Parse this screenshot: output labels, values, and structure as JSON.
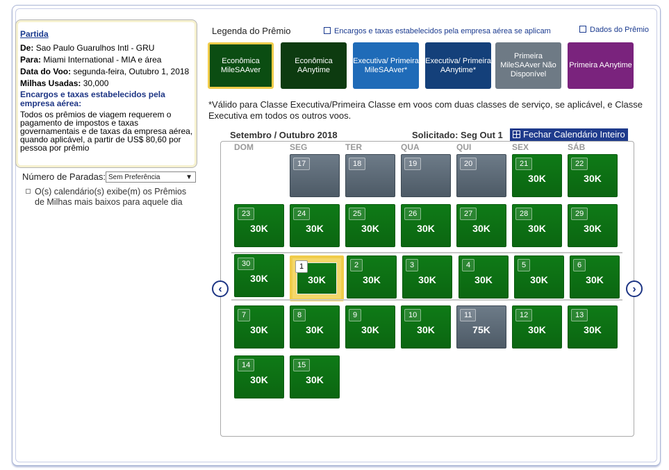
{
  "summary": {
    "departure_label": "Partida",
    "from_label": "De:",
    "from_value": "Sao Paulo Guarulhos Intl - GRU",
    "to_label": "Para:",
    "to_value": "Miami International - MIA e área",
    "date_label": "Data do Voo:",
    "date_value": "segunda-feira, Outubro 1, 2018",
    "miles_label": "Milhas Usadas:",
    "miles_value": "30,000",
    "fees_title": "Encargos e taxas estabelecidos pela empresa aérea:",
    "fees_text": "Todos os prêmios de viagem requerem o pagamento de impostos e taxas governamentais e de taxas da empresa aérea, quando aplicável, a partir de US$ 80,60 por pessoa por prêmio"
  },
  "stops": {
    "label": "Número de Paradas:",
    "selected": "Sem Preferência"
  },
  "calendar_note": "O(s) calendário(s) exibe(m) os Prêmios de Milhas mais baixos para aquele dia",
  "legend": {
    "title": "Legenda do Prêmio",
    "fees_link": "Encargos e taxas estabelecidos pela empresa aérea se aplicam",
    "details_link": "Dados do Prêmio",
    "items": [
      {
        "label": "Econômica MileSAAver",
        "color": "#0b4d12"
      },
      {
        "label": "Econômica AAnytime",
        "color": "#0d3b10"
      },
      {
        "label": "Executiva/ Primeira MileSAAver*",
        "color": "#1f6bb8"
      },
      {
        "label": "Executiva/ Primeira AAnytime*",
        "color": "#14407a"
      },
      {
        "label": "Primeira MileSAAver Não Disponível",
        "color": "#6e7a85"
      },
      {
        "label": "Primeira AAnytime",
        "color": "#7a237d"
      }
    ]
  },
  "note": "*Válido para Classe Executiva/Primeira Classe em voos com duas classes de serviço, se aplicável, e Classe Executiva em todos os outros voos.",
  "calendar": {
    "month": "Setembro / Outubro 2018",
    "requested": "Solicitado: Seg Out 1",
    "close_label": "Fechar Calendário Inteiro",
    "days_of_week": [
      "DOM",
      "SEG",
      "TER",
      "QUA",
      "QUI",
      "SEX",
      "SÁB"
    ],
    "days": [
      {
        "n": "17",
        "v": ""
      },
      {
        "n": "18",
        "v": ""
      },
      {
        "n": "19",
        "v": ""
      },
      {
        "n": "20",
        "v": ""
      },
      {
        "n": "21",
        "v": "30K"
      },
      {
        "n": "22",
        "v": "30K"
      },
      {
        "n": "23",
        "v": "30K"
      },
      {
        "n": "24",
        "v": "30K"
      },
      {
        "n": "25",
        "v": "30K"
      },
      {
        "n": "26",
        "v": "30K"
      },
      {
        "n": "27",
        "v": "30K"
      },
      {
        "n": "28",
        "v": "30K"
      },
      {
        "n": "29",
        "v": "30K"
      },
      {
        "n": "30",
        "v": "30K"
      },
      {
        "n": "1",
        "v": "30K"
      },
      {
        "n": "2",
        "v": "30K"
      },
      {
        "n": "3",
        "v": "30K"
      },
      {
        "n": "4",
        "v": "30K"
      },
      {
        "n": "5",
        "v": "30K"
      },
      {
        "n": "6",
        "v": "30K"
      },
      {
        "n": "7",
        "v": "30K"
      },
      {
        "n": "8",
        "v": "30K"
      },
      {
        "n": "9",
        "v": "30K"
      },
      {
        "n": "10",
        "v": "30K"
      },
      {
        "n": "11",
        "v": "75K"
      },
      {
        "n": "12",
        "v": "30K"
      },
      {
        "n": "13",
        "v": "30K"
      },
      {
        "n": "14",
        "v": "30K"
      },
      {
        "n": "15",
        "v": "30K"
      }
    ]
  },
  "nav": {
    "prev": "‹",
    "next": "›"
  }
}
